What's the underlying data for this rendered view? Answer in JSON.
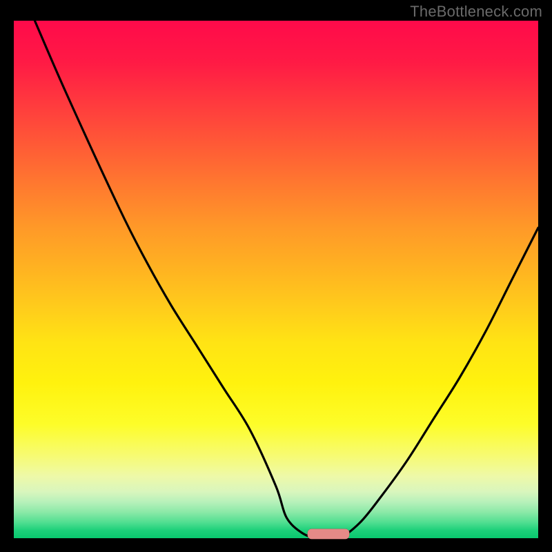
{
  "watermark": "TheBottleneck.com",
  "colors": {
    "background": "#000000",
    "curve_stroke": "#000000",
    "marker_fill": "#e58a87"
  },
  "chart_data": {
    "type": "line",
    "title": "",
    "xlabel": "",
    "ylabel": "",
    "xlim": [
      0,
      100
    ],
    "ylim": [
      0,
      100
    ],
    "grid": false,
    "series": [
      {
        "name": "bottleneck-curve",
        "x": [
          4,
          10,
          20,
          25,
          30,
          35,
          40,
          45,
          50,
          52,
          55,
          58,
          62,
          66,
          70,
          75,
          80,
          85,
          90,
          95,
          100
        ],
        "y": [
          100,
          86,
          64,
          54,
          45,
          37,
          29,
          21,
          10,
          4,
          1,
          0,
          0,
          3,
          8,
          15,
          23,
          31,
          40,
          50,
          60
        ]
      }
    ],
    "marker": {
      "x_center": 60,
      "y": 0,
      "width": 8,
      "height": 2
    }
  }
}
